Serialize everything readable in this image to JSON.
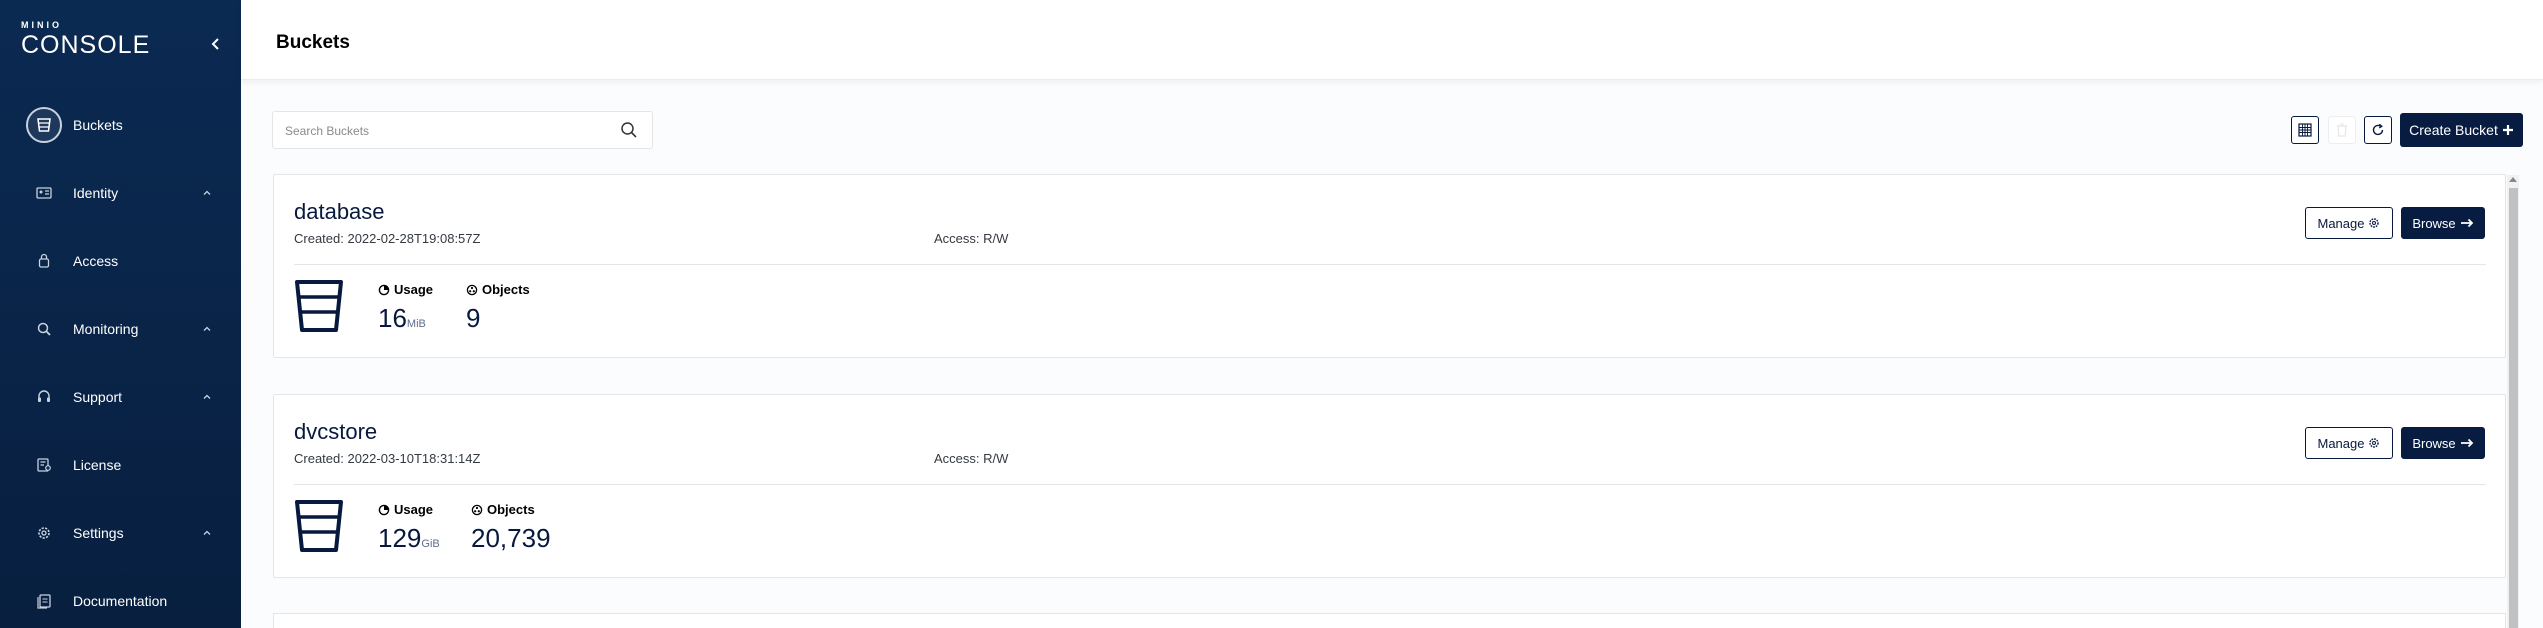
{
  "app": {
    "logo_small": "MINIO",
    "logo_main": "CONSOLE"
  },
  "sidebar": {
    "items": [
      {
        "label": "Buckets",
        "icon": "bucket-icon",
        "active": true,
        "expandable": false
      },
      {
        "label": "Identity",
        "icon": "id-card-icon",
        "active": false,
        "expandable": true
      },
      {
        "label": "Access",
        "icon": "lock-icon",
        "active": false,
        "expandable": false
      },
      {
        "label": "Monitoring",
        "icon": "magnifier-icon",
        "active": false,
        "expandable": true
      },
      {
        "label": "Support",
        "icon": "headset-icon",
        "active": false,
        "expandable": true
      },
      {
        "label": "License",
        "icon": "license-icon",
        "active": false,
        "expandable": false
      },
      {
        "label": "Settings",
        "icon": "gear-icon",
        "active": false,
        "expandable": true
      },
      {
        "label": "Documentation",
        "icon": "document-icon",
        "active": false,
        "expandable": false
      }
    ]
  },
  "header": {
    "title": "Buckets"
  },
  "toolbar": {
    "search_placeholder": "Search Buckets",
    "create_label": "Create Bucket"
  },
  "buckets": [
    {
      "name": "database",
      "created": "Created: 2022-02-28T19:08:57Z",
      "access": "Access: R/W",
      "usage_label": "Usage",
      "usage_value": "16",
      "usage_unit": "MiB",
      "objects_label": "Objects",
      "objects_value": "9",
      "manage_label": "Manage",
      "browse_label": "Browse"
    },
    {
      "name": "dvcstore",
      "created": "Created: 2022-03-10T18:31:14Z",
      "access": "Access: R/W",
      "usage_label": "Usage",
      "usage_value": "129",
      "usage_unit": "GiB",
      "objects_label": "Objects",
      "objects_value": "20,739",
      "manage_label": "Manage",
      "browse_label": "Browse"
    }
  ],
  "colors": {
    "sidebar_bg": "#0b2a52",
    "primary": "#081c42",
    "text": "#07193e"
  }
}
